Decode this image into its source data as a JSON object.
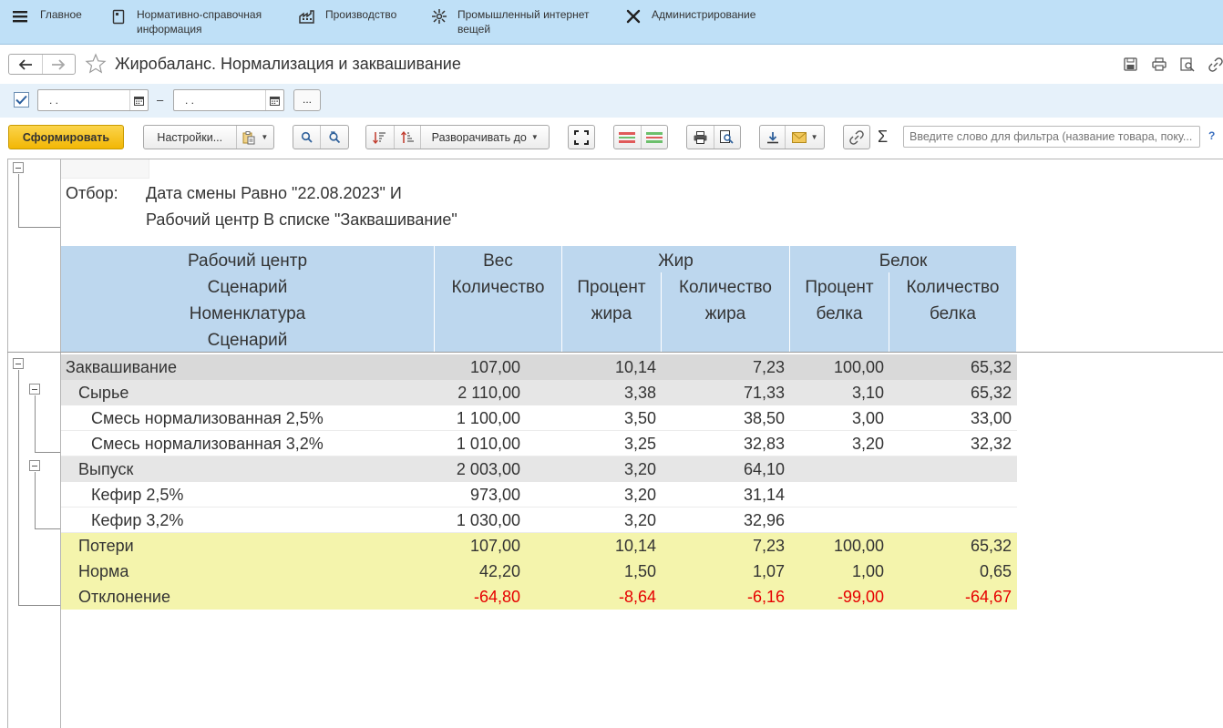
{
  "nav": {
    "menu_icon": "hamburger-icon",
    "items": [
      {
        "label": "Главное",
        "icon": "none"
      },
      {
        "label": "Нормативно-справочная\nинформация",
        "icon": "document-icon"
      },
      {
        "label": "Производство",
        "icon": "factory-icon"
      },
      {
        "label": "Промышленный интернет\nвещей",
        "icon": "iot-icon"
      },
      {
        "label": "Администрирование",
        "icon": "tools-icon"
      }
    ]
  },
  "title": "Жиробаланс. Нормализация и заквашивание",
  "period": {
    "from": " .  .",
    "to": " .  .",
    "dash": "–",
    "more": "..."
  },
  "toolbar": {
    "generate": "Сформировать",
    "settings": "Настройки...",
    "expand_to": "Разворачивать до",
    "filter_placeholder": "Введите слово для фильтра (название товара, поку...",
    "sigma": "Σ",
    "help": "?"
  },
  "report": {
    "filter_label": "Отбор:",
    "filter_lines": [
      "Дата смены Равно \"22.08.2023\" И",
      "Рабочий центр В списке \"Заквашивание\""
    ],
    "headers": {
      "group": [
        "Рабочий центр",
        "Сценарий",
        "Номенклатура",
        "Сценарий"
      ],
      "weight_title": "Вес",
      "weight_qty": "Количество",
      "fat_title": "Жир",
      "fat_pct": [
        "Процент",
        "жира"
      ],
      "fat_qty": [
        "Количество",
        "жира"
      ],
      "protein_title": "Белок",
      "protein_pct": [
        "Процент",
        "белка"
      ],
      "protein_qty": [
        "Количество",
        "белка"
      ]
    },
    "rows": [
      {
        "name": "Заквашивание",
        "kind": "lvl0",
        "weight": "107,00",
        "fat_pct": "10,14",
        "fat_qty": "7,23",
        "prot_pct": "100,00",
        "prot_qty": "65,32"
      },
      {
        "name": "Сырье",
        "kind": "lvl1",
        "weight": "2 110,00",
        "fat_pct": "3,38",
        "fat_qty": "71,33",
        "prot_pct": "3,10",
        "prot_qty": "65,32"
      },
      {
        "name": "Смесь нормализованная 2,5%",
        "kind": "item",
        "weight": "1 100,00",
        "fat_pct": "3,50",
        "fat_qty": "38,50",
        "prot_pct": "3,00",
        "prot_qty": "33,00"
      },
      {
        "name": "Смесь нормализованная 3,2%",
        "kind": "item",
        "weight": "1 010,00",
        "fat_pct": "3,25",
        "fat_qty": "32,83",
        "prot_pct": "3,20",
        "prot_qty": "32,32"
      },
      {
        "name": "Выпуск",
        "kind": "lvl1",
        "weight": "2 003,00",
        "fat_pct": "3,20",
        "fat_qty": "64,10",
        "prot_pct": "",
        "prot_qty": ""
      },
      {
        "name": "Кефир 2,5%",
        "kind": "item",
        "weight": "973,00",
        "fat_pct": "3,20",
        "fat_qty": "31,14",
        "prot_pct": "",
        "prot_qty": ""
      },
      {
        "name": "Кефир 3,2%",
        "kind": "item",
        "weight": "1 030,00",
        "fat_pct": "3,20",
        "fat_qty": "32,96",
        "prot_pct": "",
        "prot_qty": ""
      },
      {
        "name": "Потери",
        "kind": "sum",
        "weight": "107,00",
        "fat_pct": "10,14",
        "fat_qty": "7,23",
        "prot_pct": "100,00",
        "prot_qty": "65,32"
      },
      {
        "name": "Норма",
        "kind": "sum",
        "weight": "42,20",
        "fat_pct": "1,50",
        "fat_qty": "1,07",
        "prot_pct": "1,00",
        "prot_qty": "0,65"
      },
      {
        "name": "Отклонение",
        "kind": "sum",
        "weight": "-64,80",
        "fat_pct": "-8,64",
        "fat_qty": "-6,16",
        "prot_pct": "-99,00",
        "prot_qty": "-64,67"
      }
    ]
  },
  "colors": {
    "nav_bg": "#bfe0f7",
    "header_bg": "#bdd7ee",
    "group_bg": "#d9d9d9",
    "subgroup_bg": "#e6e6e6",
    "summary_bg": "#f4f4ac",
    "negative": "#e60000",
    "primary_button": "#f2b705"
  }
}
